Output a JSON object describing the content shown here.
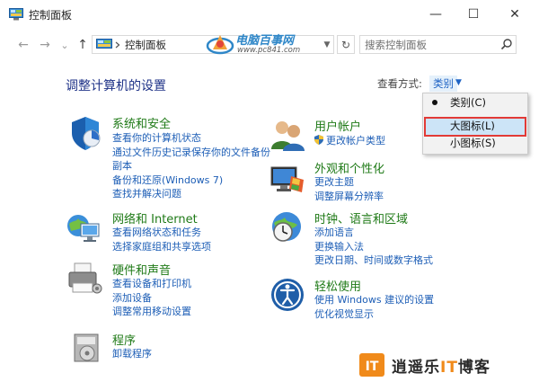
{
  "window": {
    "title": "控制面板",
    "minimize": "—",
    "maximize": "☐",
    "close": "✕"
  },
  "nav": {
    "back": "←",
    "forward": "→",
    "recent": "⌄",
    "up": "↑",
    "address_path": "控制面板",
    "address_dropdown": "▼",
    "refresh": "↻",
    "search_placeholder": "搜索控制面板"
  },
  "watermark": {
    "site": "电脑百事网",
    "url": "www.pc841.com"
  },
  "page": {
    "title": "调整计算机的设置",
    "view_by_label": "查看方式:",
    "view_by_value": "类别",
    "view_by_arrow": "▼"
  },
  "categories": [
    {
      "title": "系统和安全",
      "links": [
        "查看你的计算机状态",
        "通过文件历史记录保存你的文件备份",
        "副本",
        "备份和还原(Windows 7)",
        "查找并解决问题"
      ]
    },
    {
      "title": "网络和 Internet",
      "links": [
        "查看网络状态和任务",
        "选择家庭组和共享选项"
      ]
    },
    {
      "title": "硬件和声音",
      "links": [
        "查看设备和打印机",
        "添加设备",
        "调整常用移动设置"
      ]
    },
    {
      "title": "程序",
      "links": [
        "卸载程序"
      ]
    },
    {
      "title": "用户帐户",
      "links": [
        "更改帐户类型"
      ]
    },
    {
      "title": "外观和个性化",
      "links": [
        "更改主题",
        "调整屏幕分辨率"
      ]
    },
    {
      "title": "时钟、语言和区域",
      "links": [
        "添加语言",
        "更换输入法",
        "更改日期、时间或数字格式"
      ]
    },
    {
      "title": "轻松使用",
      "links": [
        "使用 Windows 建议的设置",
        "优化视觉显示"
      ]
    }
  ],
  "view_menu": {
    "items": [
      "类别(C)",
      "大图标(L)",
      "小图标(S)"
    ],
    "selected": "类别(C)",
    "highlighted": "大图标(L)"
  },
  "brand": {
    "mark": "IT",
    "text_pre": "逍遥乐",
    "text_accent": "IT",
    "text_post": "博客"
  },
  "colors": {
    "category_title": "#1f7a17",
    "link": "#1d5eb6",
    "heading": "#1e3287",
    "menu_highlight_border": "#e23a36",
    "menu_highlight_fill": "#cce4f7",
    "brand_accent": "#f08a1a"
  }
}
